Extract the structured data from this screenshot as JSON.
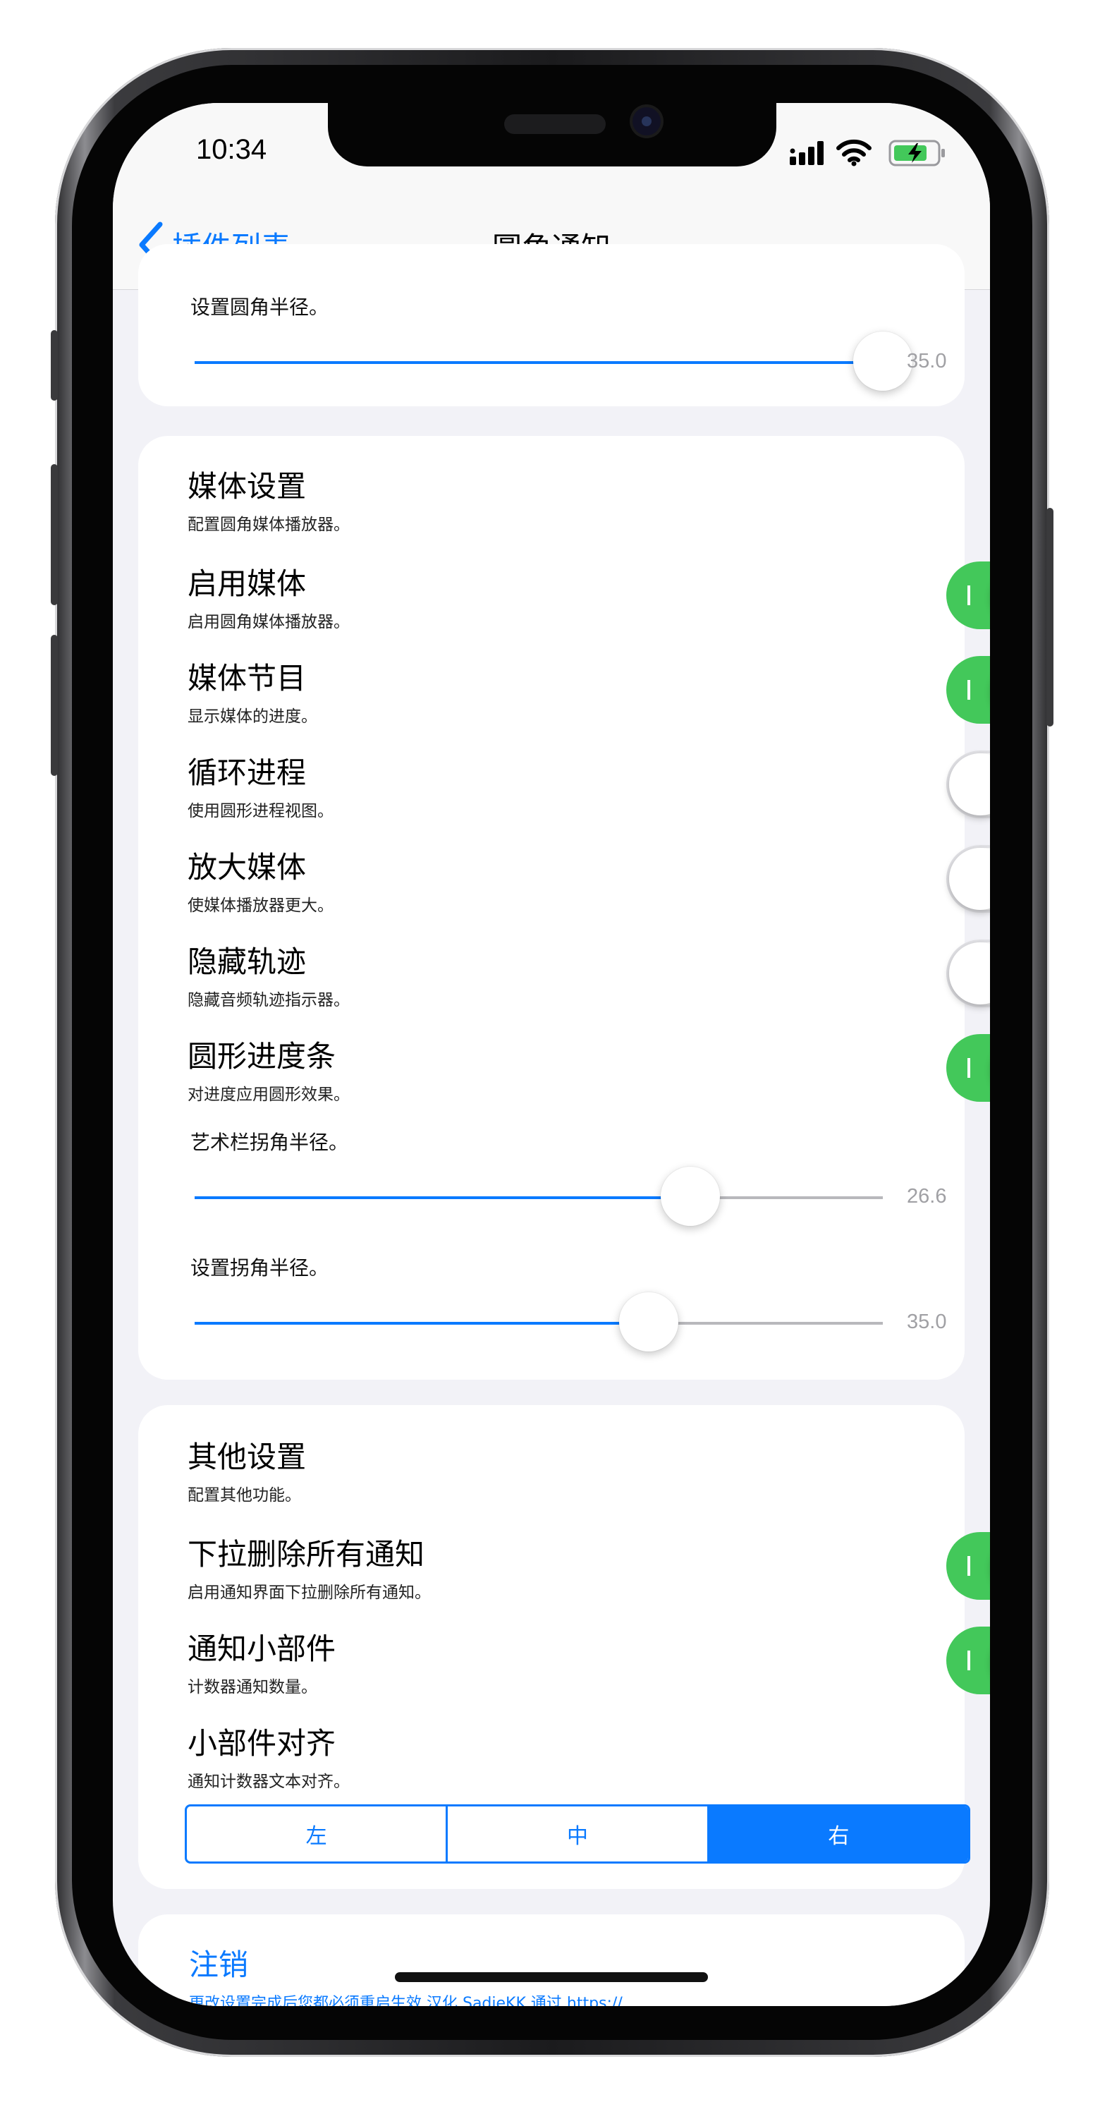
{
  "status_bar": {
    "time": "10:34"
  },
  "nav": {
    "back_label": "插件列表",
    "title": "圆角通知"
  },
  "top_card": {
    "slider_label": "设置圆角半径。",
    "slider": {
      "value_text": "35.0",
      "fraction": 1.0
    }
  },
  "media_section": {
    "title": "媒体设置",
    "subtitle": "配置圆角媒体播放器。",
    "rows": [
      {
        "title": "启用媒体",
        "subtitle": "启用圆角媒体播放器。",
        "on": true
      },
      {
        "title": "媒体节目",
        "subtitle": "显示媒体的进度。",
        "on": true
      },
      {
        "title": "循环进程",
        "subtitle": "使用圆形进程视图。",
        "on": false
      },
      {
        "title": "放大媒体",
        "subtitle": "使媒体播放器更大。",
        "on": false
      },
      {
        "title": "隐藏轨迹",
        "subtitle": "隐藏音频轨迹指示器。",
        "on": false
      },
      {
        "title": "圆形进度条",
        "subtitle": "对进度应用圆形效果。",
        "on": true
      }
    ],
    "sliders": [
      {
        "label": "艺术栏拐角半径。",
        "value_text": "26.6",
        "fraction": 0.72
      },
      {
        "label": "设置拐角半径。",
        "value_text": "35.0",
        "fraction": 0.66
      }
    ]
  },
  "other_section": {
    "title": "其他设置",
    "subtitle": "配置其他功能。",
    "rows": [
      {
        "title": "下拉删除所有通知",
        "subtitle": "启用通知界面下拉删除所有通知。",
        "on": true
      },
      {
        "title": "通知小部件",
        "subtitle": "计数器通知数量。",
        "on": true
      }
    ],
    "align": {
      "title": "小部件对齐",
      "subtitle": "通知计数器文本对齐。",
      "options": [
        "左",
        "中",
        "右"
      ],
      "selected": "右"
    }
  },
  "logout": {
    "label": "注销",
    "note": "更改设置完成后您都必须重启生效 汉化 SadieKK 通过 https://..."
  },
  "colors": {
    "accent": "#0a7aff",
    "toggle_on": "#43c85a",
    "background": "#f2f2f7"
  }
}
